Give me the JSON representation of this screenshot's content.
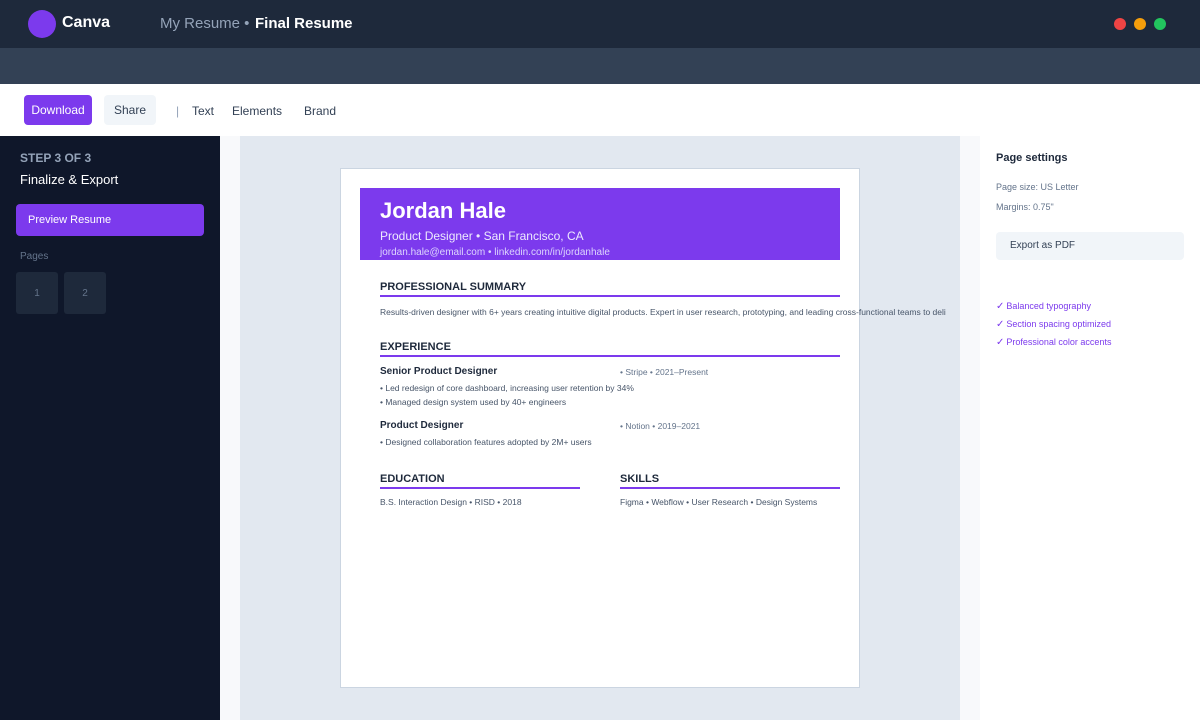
{
  "titlebar": {
    "app_name": "Canva",
    "breadcrumb_parent": "My Resume •",
    "breadcrumb_current": "Final Resume"
  },
  "toolbar": {
    "download_label": "Download",
    "share_label": "Share",
    "separator": "|",
    "text_label": "Text",
    "elements_label": "Elements",
    "brand_label": "Brand"
  },
  "sidebar": {
    "step_label": "STEP 3 OF 3",
    "step_title": "Finalize & Export",
    "preview_label": "Preview Resume",
    "pages_label": "Pages",
    "pages": [
      "1",
      "2"
    ]
  },
  "resume": {
    "name": "Jordan Hale",
    "tagline": "Product Designer • San Francisco, CA",
    "contact": "jordan.hale@email.com • linkedin.com/in/jordanhale",
    "summary_heading": "PROFESSIONAL SUMMARY",
    "summary": "Results-driven designer with 6+ years creating intuitive digital products. Expert in user research, prototyping, and leading cross-functional teams to deli",
    "experience_heading": "EXPERIENCE",
    "jobs": [
      {
        "title": "Senior Product Designer",
        "meta": "• Stripe • 2021–Present",
        "bullets": [
          "• Led redesign of core dashboard, increasing user retention by 34%",
          "• Managed design system used by 40+ engineers"
        ]
      },
      {
        "title": "Product Designer",
        "meta": "• Notion • 2019–2021",
        "bullets": [
          "• Designed collaboration features adopted by 2M+ users"
        ]
      }
    ],
    "education_heading": "EDUCATION",
    "education": "B.S. Interaction Design • RISD • 2018",
    "skills_heading": "SKILLS",
    "skills": "Figma • Webflow • User Research • Design Systems"
  },
  "right_panel": {
    "title": "Page settings",
    "page_size": "Page size: US Letter",
    "margins": "Margins: 0.75\"",
    "export_label": "Export as PDF",
    "checks": [
      "Balanced typography",
      "Section spacing optimized",
      "Professional color accents"
    ]
  },
  "colors": {
    "accent": "#7c3aed",
    "titlebar": "#1e293b",
    "sidebar": "#0f172a",
    "window_close": "#ef4444",
    "window_minimize": "#f59e0b",
    "window_maximize": "#22c55e"
  }
}
